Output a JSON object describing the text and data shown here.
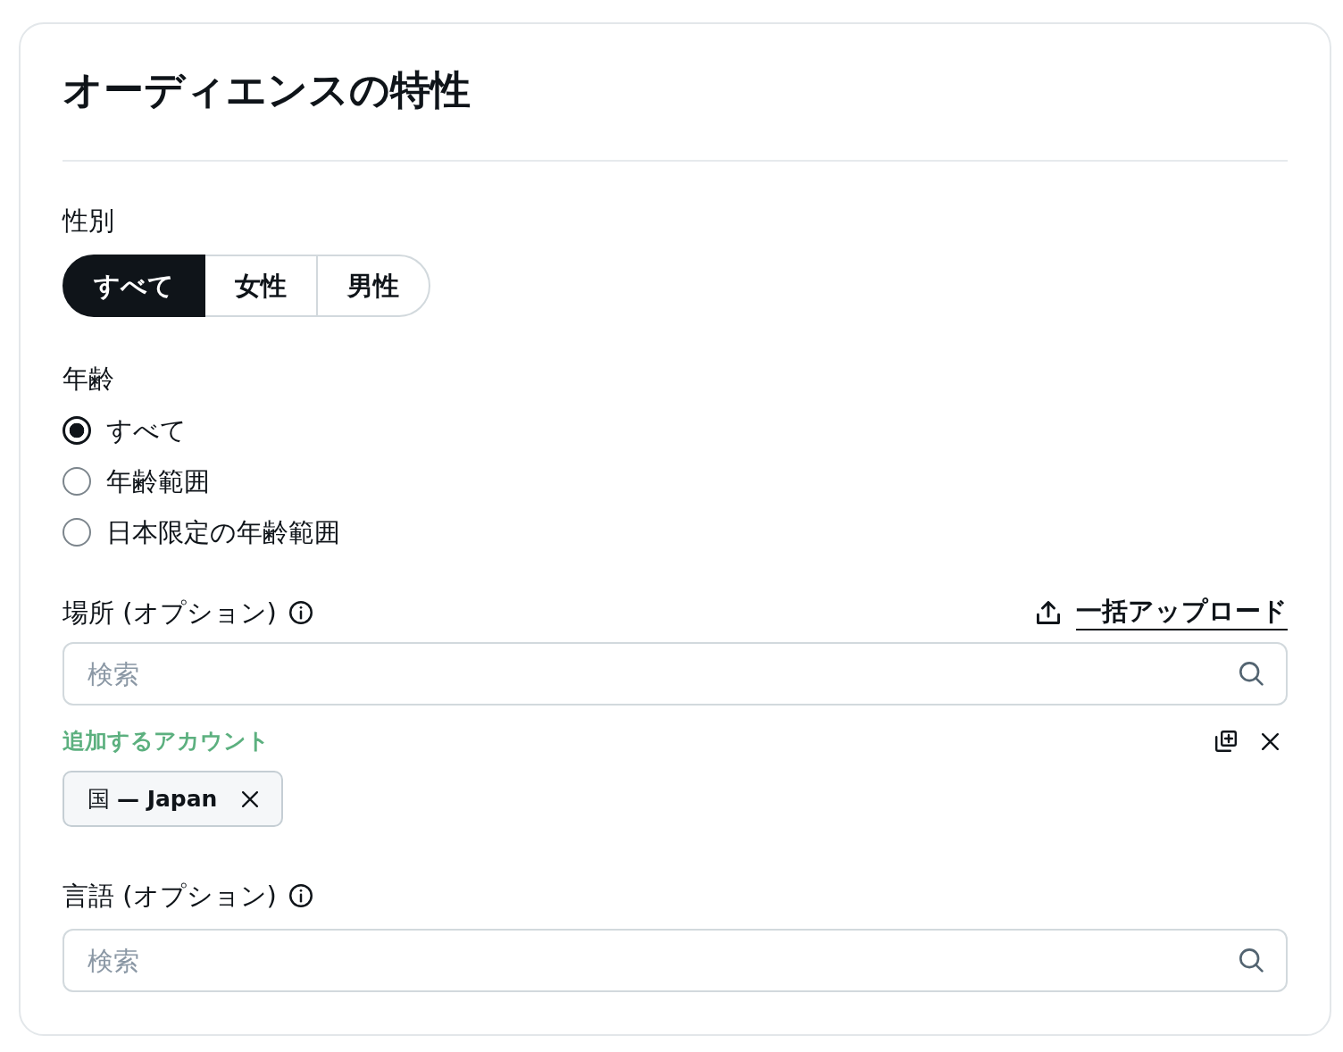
{
  "card": {
    "title": "オーディエンスの特性"
  },
  "gender": {
    "label": "性別",
    "options": [
      {
        "label": "すべて",
        "selected": true
      },
      {
        "label": "女性",
        "selected": false
      },
      {
        "label": "男性",
        "selected": false
      }
    ]
  },
  "age": {
    "label": "年齢",
    "options": [
      {
        "label": "すべて",
        "selected": true
      },
      {
        "label": "年齢範囲",
        "selected": false
      },
      {
        "label": "日本限定の年齢範囲",
        "selected": false
      }
    ]
  },
  "location": {
    "label": "場所 (オプション)",
    "bulk_upload": "一括アップロード",
    "search": {
      "placeholder": "検索"
    },
    "selected_heading": "追加するアカウント",
    "chips": [
      {
        "label": "国 **— Japan**"
      }
    ]
  },
  "language": {
    "label": "言語 (オプション)",
    "search": {
      "placeholder": "検索"
    }
  }
}
